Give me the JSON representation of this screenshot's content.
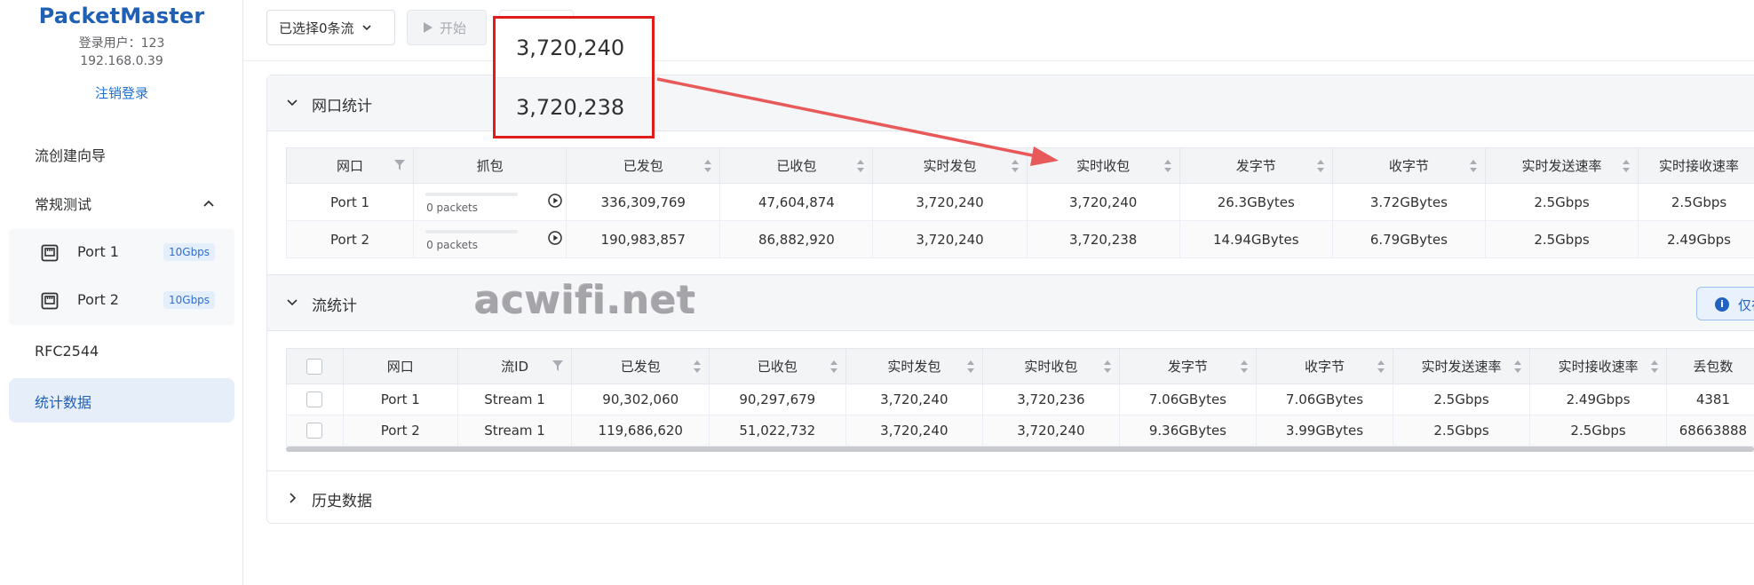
{
  "app": {
    "brand": "PacketMaster",
    "user_line": "登录用户：123",
    "ip": "192.168.0.39",
    "logout": "注销登录"
  },
  "sidebar": {
    "items": [
      {
        "label": "流创建向导"
      },
      {
        "label": "常规测试"
      },
      {
        "label": "RFC2544"
      },
      {
        "label": "统计数据"
      }
    ],
    "ports": [
      {
        "label": "Port 1",
        "badge": "10Gbps"
      },
      {
        "label": "Port 2",
        "badge": "10Gbps"
      }
    ]
  },
  "toolbar": {
    "select_label": "已选择0条流",
    "start_label": "开始"
  },
  "sections": {
    "port_stats": "网口统计",
    "flow_stats": "流统计",
    "history": "历史数据"
  },
  "notice": {
    "text": "仅在"
  },
  "port_table": {
    "headers": [
      "网口",
      "抓包",
      "已发包",
      "已收包",
      "实时发包",
      "实时收包",
      "发字节",
      "收字节",
      "实时发送速率",
      "实时接收速率"
    ],
    "rows": [
      {
        "port": "Port 1",
        "capture": "0 packets",
        "tx": "336,309,769",
        "rx": "47,604,874",
        "rt_tx": "3,720,240",
        "rt_rx": "3,720,240",
        "tx_bytes": "26.3GBytes",
        "rx_bytes": "3.72GBytes",
        "tx_rate": "2.5Gbps",
        "rx_rate": "2.5Gbps"
      },
      {
        "port": "Port 2",
        "capture": "0 packets",
        "tx": "190,983,857",
        "rx": "86,882,920",
        "rt_tx": "3,720,240",
        "rt_rx": "3,720,238",
        "tx_bytes": "14.94GBytes",
        "rx_bytes": "6.79GBytes",
        "tx_rate": "2.5Gbps",
        "rx_rate": "2.49Gbps"
      }
    ]
  },
  "flow_table": {
    "headers": [
      "网口",
      "流ID",
      "已发包",
      "已收包",
      "实时发包",
      "实时收包",
      "发字节",
      "收字节",
      "实时发送速率",
      "实时接收速率",
      "丢包数"
    ],
    "rows": [
      {
        "port": "Port 1",
        "stream": "Stream 1",
        "tx": "90,302,060",
        "rx": "90,297,679",
        "rt_tx": "3,720,240",
        "rt_rx": "3,720,236",
        "tx_bytes": "7.06GBytes",
        "rx_bytes": "7.06GBytes",
        "tx_rate": "2.5Gbps",
        "rx_rate": "2.49Gbps",
        "lost": "4381"
      },
      {
        "port": "Port 2",
        "stream": "Stream 1",
        "tx": "119,686,620",
        "rx": "51,022,732",
        "rt_tx": "3,720,240",
        "rt_rx": "3,720,240",
        "tx_bytes": "9.36GBytes",
        "rx_bytes": "3.99GBytes",
        "tx_rate": "2.5Gbps",
        "rx_rate": "2.5Gbps",
        "lost": "68663888"
      }
    ]
  },
  "callout": {
    "top": "3,720,240",
    "bottom": "3,720,238"
  },
  "watermark": "acwifi.net",
  "colors": {
    "brand": "#1f5fb4",
    "highlight_border": "#e01c1c",
    "arrow": "#e85a5a",
    "active_nav_bg": "#e6eefa"
  }
}
